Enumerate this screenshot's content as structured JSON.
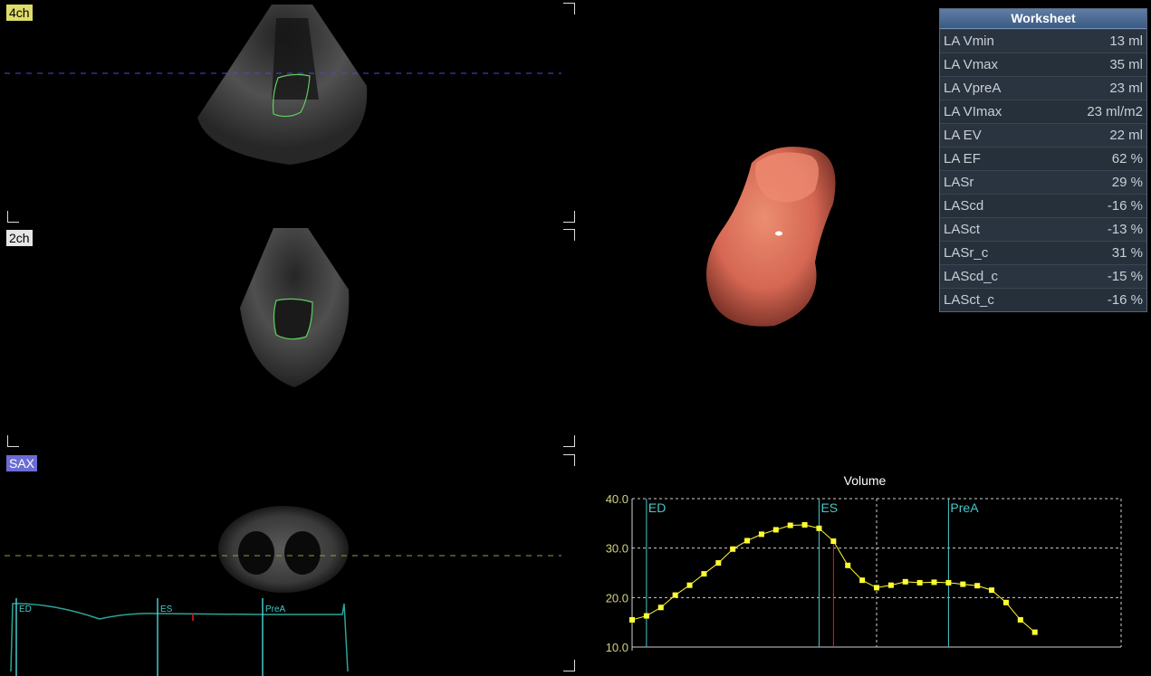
{
  "views": {
    "four_ch": "4ch",
    "two_ch": "2ch",
    "sax": "SAX"
  },
  "worksheet": {
    "title": "Worksheet",
    "rows": [
      {
        "label": "LA Vmin",
        "value": "13 ml"
      },
      {
        "label": "LA Vmax",
        "value": "35 ml"
      },
      {
        "label": "LA VpreA",
        "value": "23 ml"
      },
      {
        "label": "LA VImax",
        "value": "23 ml/m2"
      },
      {
        "label": "LA EV",
        "value": "22 ml"
      },
      {
        "label": "LA EF",
        "value": "62 %"
      },
      {
        "label": "LASr",
        "value": "29 %"
      },
      {
        "label": "LAScd",
        "value": "-16 %"
      },
      {
        "label": "LASct",
        "value": "-13 %"
      },
      {
        "label": "LASr_c",
        "value": "31 %"
      },
      {
        "label": "LAScd_c",
        "value": "-15 %"
      },
      {
        "label": "LASct_c",
        "value": "-16 %"
      }
    ]
  },
  "strain_trace": {
    "markers": [
      "ED",
      "ES",
      "PreA"
    ]
  },
  "colors": {
    "trace": "#2aa596",
    "marker": "#48c8c8",
    "series": "#ffff33",
    "cursor": "#e02020",
    "tick": "#d6d27a"
  },
  "chart_data": {
    "type": "line",
    "title": "Volume",
    "xlabel": "",
    "ylabel": "",
    "ylim": [
      10,
      40
    ],
    "yticks": [
      "10.0",
      "20.0",
      "30.0",
      "40.0"
    ],
    "grid": true,
    "markers": [
      {
        "label": "ED",
        "x": 1
      },
      {
        "label": "ES",
        "x": 13
      },
      {
        "label": "PreA",
        "x": 22
      }
    ],
    "cursor_x": 14,
    "series": [
      {
        "values": [
          15.5,
          16.3,
          18.0,
          20.5,
          22.5,
          24.8,
          27.0,
          29.8,
          31.5,
          32.8,
          33.7,
          34.6,
          34.7,
          34.0,
          31.4,
          26.5,
          23.5,
          22.0,
          22.5,
          23.2,
          23.0,
          23.1,
          23.0,
          22.7,
          22.4,
          21.5,
          19.0,
          15.5,
          13.0
        ]
      }
    ]
  }
}
